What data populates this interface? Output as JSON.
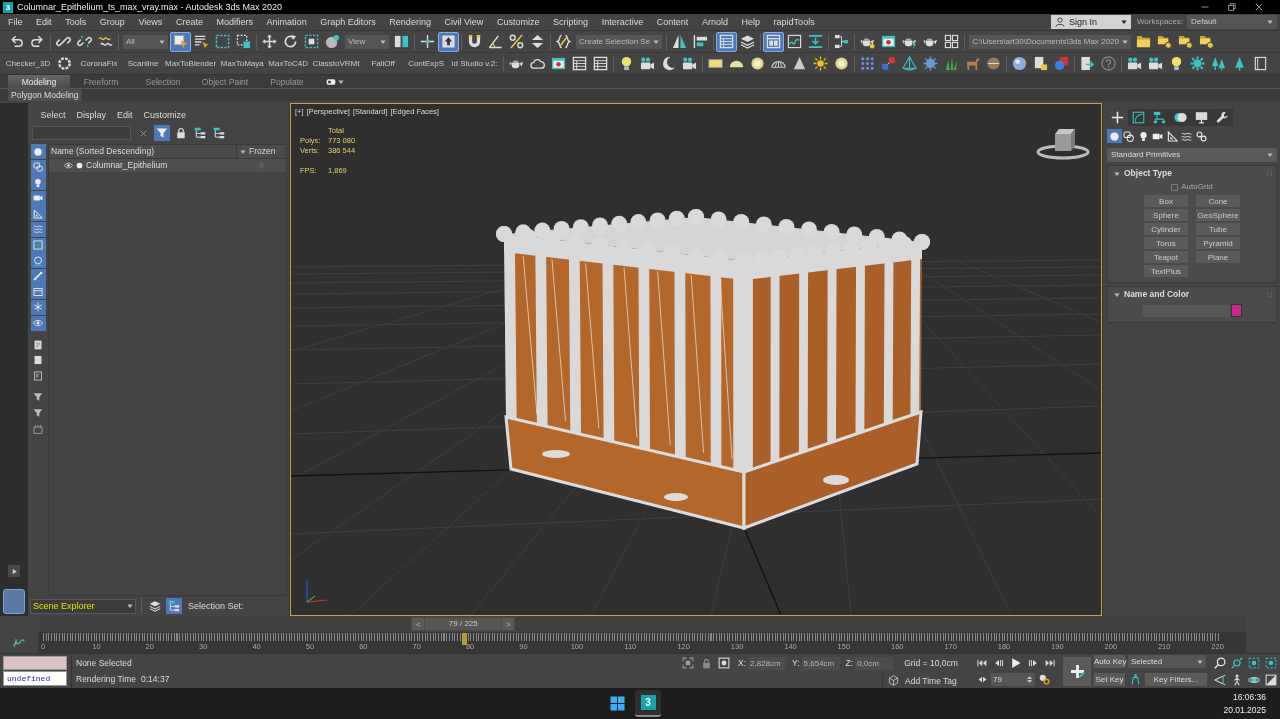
{
  "window": {
    "logo": "3",
    "title": "Columnar_Epithelium_ts_max_vray.max - Autodesk 3ds Max 2020"
  },
  "menu_bar": {
    "items": [
      "File",
      "Edit",
      "Tools",
      "Group",
      "Views",
      "Create",
      "Modifiers",
      "Animation",
      "Graph Editors",
      "Rendering",
      "Civil View",
      "Customize",
      "Scripting",
      "Interactive",
      "Content",
      "Arnold",
      "Help",
      "rapidTools"
    ],
    "sign_in": "Sign In",
    "workspaces_label": "Workspaces:",
    "workspace": "Default"
  },
  "main_toolbar": [
    {
      "kind": "button",
      "selected": false
    },
    {
      "kind": "button",
      "selected": false
    },
    {
      "kind": "separator"
    },
    {
      "kind": "button",
      "selected": false
    },
    {
      "kind": "button",
      "selected": false
    },
    {
      "kind": "button",
      "selected": false
    },
    {
      "kind": "separator"
    },
    {
      "kind": "dropdown",
      "value": "All"
    },
    {
      "kind": "button",
      "selected": true
    },
    {
      "kind": "button",
      "selected": false
    },
    {
      "kind": "button",
      "selected": false
    },
    {
      "kind": "button",
      "selected": false
    },
    {
      "kind": "separator"
    },
    {
      "kind": "button",
      "selected": false
    },
    {
      "kind": "button",
      "selected": false
    },
    {
      "kind": "button",
      "selected": false
    },
    {
      "kind": "button",
      "selected": false
    },
    {
      "kind": "dropdown",
      "value": "View"
    },
    {
      "kind": "button",
      "selected": false
    },
    {
      "kind": "separator"
    },
    {
      "kind": "button",
      "selected": false
    },
    {
      "kind": "button",
      "selected": true
    },
    {
      "kind": "separator"
    },
    {
      "kind": "button",
      "selected": false
    },
    {
      "kind": "button",
      "selected": false
    },
    {
      "kind": "button",
      "selected": false
    },
    {
      "kind": "button",
      "selected": false
    },
    {
      "kind": "separator"
    },
    {
      "kind": "button",
      "selected": false
    },
    {
      "kind": "dropdown",
      "value": "Create Selection Se"
    },
    {
      "kind": "separator"
    },
    {
      "kind": "button",
      "selected": false
    },
    {
      "kind": "button",
      "selected": false
    },
    {
      "kind": "separator"
    },
    {
      "kind": "button",
      "selected": true
    },
    {
      "kind": "button",
      "selected": false
    },
    {
      "kind": "separator"
    },
    {
      "kind": "button",
      "selected": true
    },
    {
      "kind": "button",
      "selected": false
    },
    {
      "kind": "button",
      "selected": false
    },
    {
      "kind": "separator"
    },
    {
      "kind": "button",
      "selected": false
    },
    {
      "kind": "separator"
    },
    {
      "kind": "button",
      "selected": false
    },
    {
      "kind": "button",
      "selected": false
    },
    {
      "kind": "button",
      "selected": false
    },
    {
      "kind": "button",
      "selected": false
    },
    {
      "kind": "button",
      "selected": false
    },
    {
      "kind": "separator"
    },
    {
      "kind": "dropdown",
      "value": "C:\\Users\\art30\\Documents\\3ds Max 2020"
    },
    {
      "kind": "button",
      "selected": false
    },
    {
      "kind": "button",
      "selected": false
    },
    {
      "kind": "button",
      "selected": false
    },
    {
      "kind": "button",
      "selected": false
    }
  ],
  "custom_toolbar": [
    {
      "kind": "text",
      "label": "Checker_3D"
    },
    {
      "kind": "button",
      "selected": false
    },
    {
      "kind": "text",
      "label": "CoronaFix"
    },
    {
      "kind": "text",
      "label": "Scanline"
    },
    {
      "kind": "text",
      "label": "MaxToBlender"
    },
    {
      "kind": "text",
      "label": "MaxToMaya"
    },
    {
      "kind": "text",
      "label": "MaxToC4D"
    },
    {
      "kind": "text",
      "label": "ClasstoVRMt"
    },
    {
      "kind": "text",
      "label": "FallOff"
    },
    {
      "kind": "text",
      "label": "ContExpS"
    },
    {
      "kind": "text",
      "label": "id Studio v.2:"
    },
    {
      "kind": "separator"
    },
    {
      "kind": "button",
      "selected": false
    },
    {
      "kind": "button",
      "selected": false
    },
    {
      "kind": "button",
      "selected": false
    },
    {
      "kind": "button",
      "selected": false
    },
    {
      "kind": "button",
      "selected": false
    },
    {
      "kind": "separator"
    },
    {
      "kind": "button",
      "selected": false
    },
    {
      "kind": "button",
      "selected": false
    },
    {
      "kind": "button",
      "selected": false
    },
    {
      "kind": "button",
      "selected": false
    },
    {
      "kind": "separator"
    },
    {
      "kind": "button",
      "selected": false
    },
    {
      "kind": "button",
      "selected": false
    },
    {
      "kind": "button",
      "selected": false
    },
    {
      "kind": "button",
      "selected": false
    },
    {
      "kind": "button",
      "selected": false
    },
    {
      "kind": "button",
      "selected": false
    },
    {
      "kind": "button",
      "selected": false
    },
    {
      "kind": "separator"
    },
    {
      "kind": "button",
      "selected": false
    },
    {
      "kind": "button",
      "selected": false
    },
    {
      "kind": "button",
      "selected": false
    },
    {
      "kind": "button",
      "selected": false
    },
    {
      "kind": "button",
      "selected": false
    },
    {
      "kind": "button",
      "selected": false
    },
    {
      "kind": "button",
      "selected": false
    },
    {
      "kind": "separator"
    },
    {
      "kind": "button",
      "selected": false
    },
    {
      "kind": "button",
      "selected": false
    },
    {
      "kind": "button",
      "selected": false
    },
    {
      "kind": "separator"
    },
    {
      "kind": "button",
      "selected": false
    },
    {
      "kind": "button",
      "selected": false
    },
    {
      "kind": "separator"
    },
    {
      "kind": "button",
      "selected": false
    },
    {
      "kind": "button",
      "selected": false
    },
    {
      "kind": "button",
      "selected": false
    },
    {
      "kind": "button",
      "selected": false
    },
    {
      "kind": "button",
      "selected": false
    },
    {
      "kind": "button",
      "selected": false
    },
    {
      "kind": "button",
      "selected": false
    }
  ],
  "ribbon": {
    "tabs": [
      {
        "label": "Modeling",
        "selected": true
      },
      {
        "label": "Freeform",
        "selected": false
      },
      {
        "label": "Selection",
        "selected": false
      },
      {
        "label": "Object Paint",
        "selected": false
      },
      {
        "label": "Populate",
        "selected": false
      }
    ],
    "panel": "Polygon Modeling"
  },
  "scene_explorer": {
    "menu": [
      "Select",
      "Display",
      "Edit",
      "Customize"
    ],
    "tools": [
      {
        "selected": false
      },
      {
        "selected": true
      },
      {
        "selected": false
      },
      {
        "selected": false
      },
      {
        "selected": false
      }
    ],
    "filters": [
      {
        "selected": true
      },
      {
        "selected": true
      },
      {
        "selected": true
      },
      {
        "selected": true
      },
      {
        "selected": true
      },
      {
        "selected": true
      },
      {
        "selected": true
      },
      {
        "selected": true
      },
      {
        "selected": true
      },
      {
        "selected": true
      },
      {
        "selected": true
      },
      {
        "selected": true
      },
      {
        "selected": false
      },
      {
        "selected": false
      },
      {
        "selected": false
      },
      {
        "selected": false
      },
      {
        "selected": false
      },
      {
        "selected": false
      }
    ],
    "columns": [
      "Name (Sorted Descending)",
      "Frozen"
    ],
    "rows": [
      {
        "name": "Columnar_Epithelium",
        "visible": true
      }
    ],
    "explorer": "Scene Explorer",
    "view_buttons": [
      {
        "selected": false
      },
      {
        "selected": true
      }
    ],
    "selection_set_label": "Selection Set:"
  },
  "viewport": {
    "active": true,
    "labels": [
      "[+]",
      "[Perspective]",
      "[Standard]",
      "[Edged Faces]"
    ],
    "stats": {
      "heading": "Total",
      "rows": [
        {
          "label": "Polys:",
          "value": "773 080"
        },
        {
          "label": "Verts:",
          "value": "386 544"
        }
      ],
      "fps_label": "FPS:",
      "fps": "1,869"
    }
  },
  "command_panel": {
    "tabs": [
      {
        "selected": true
      },
      {
        "selected": false
      },
      {
        "selected": false
      },
      {
        "selected": false
      },
      {
        "selected": false
      },
      {
        "selected": false
      }
    ],
    "categories": [
      {
        "selected": true
      },
      {
        "selected": false
      },
      {
        "selected": false
      },
      {
        "selected": false
      },
      {
        "selected": false
      },
      {
        "selected": false
      },
      {
        "selected": false
      }
    ],
    "dropdown": "Standard Primitives",
    "rollouts": [
      {
        "kind": "object_type",
        "title": "Object Type",
        "expanded": true,
        "autogrid": {
          "label": "AutoGrid",
          "checked": false,
          "disabled": true
        },
        "buttons": [
          "Box",
          "Cone",
          "Sphere",
          "GeoSphere",
          "Cylinder",
          "Tube",
          "Torus",
          "Pyramid",
          "Teapot",
          "Plane",
          "TextPlus"
        ]
      },
      {
        "kind": "name_color",
        "title": "Name and Color",
        "expanded": true,
        "color": "#c8288c"
      }
    ]
  },
  "time_slider": {
    "prev": "<",
    "label": "79 / 225",
    "next": ">"
  },
  "trackbar": {
    "labels": [
      "0",
      "10",
      "20",
      "30",
      "40",
      "50",
      "60",
      "70",
      "80",
      "90",
      "100",
      "110",
      "120",
      "130",
      "140",
      "150",
      "160",
      "170",
      "180",
      "190",
      "200",
      "210",
      "220"
    ],
    "current_frame": {
      "level": 0.351
    }
  },
  "status_bar": {
    "listener_output": "undefined",
    "selection": "None Selected",
    "render_label": "Rendering Time",
    "render_time": "0:14:37",
    "coords": [
      {
        "label": "X:",
        "value": "2,828cm",
        "disabled": true
      },
      {
        "label": "Y:",
        "value": "5,654cm",
        "disabled": true
      },
      {
        "label": "Z:",
        "value": "0,0cm",
        "disabled": true
      }
    ],
    "grid": "Grid = 10,0cm",
    "time_tag": "Add Time Tag"
  },
  "playback": {
    "frame": "79"
  },
  "keys": {
    "auto_key": {
      "label": "Auto Key",
      "on": false
    },
    "key_mode": "Selected",
    "set_key": "Set Key",
    "key_filters": "Key Filters..."
  },
  "taskbar": {
    "app": {
      "logo": "3",
      "running": true
    },
    "time": "16:06:36",
    "date": "20.01.2025"
  }
}
